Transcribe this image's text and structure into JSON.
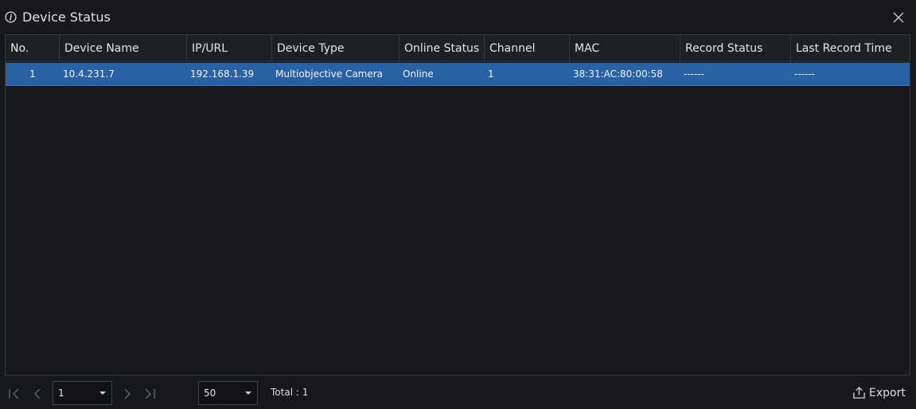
{
  "window": {
    "title": "Device Status",
    "title_icon": "info-icon",
    "close_icon": "close-icon"
  },
  "table": {
    "columns": [
      "No.",
      "Device Name",
      "IP/URL",
      "Device Type",
      "Online Status",
      "Channel",
      "MAC",
      "Record Status",
      "Last Record Time"
    ],
    "rows": [
      {
        "no": "1",
        "device_name": "10.4.231.7",
        "ip_url": "192.168.1.39",
        "device_type": "Multiobjective Camera",
        "online_status": "Online",
        "channel": "1",
        "mac": "38:31:AC:80:00:58",
        "record_status": "------",
        "last_record_time": "------"
      }
    ],
    "selected_row_color": "#2a61a3"
  },
  "footer": {
    "page_select": "1",
    "page_size_select": "50",
    "total_text": "Total : 1",
    "export_label": "Export",
    "icons": [
      "first-page-icon",
      "previous-page-icon",
      "next-page-icon",
      "last-page-icon",
      "export-icon"
    ]
  }
}
